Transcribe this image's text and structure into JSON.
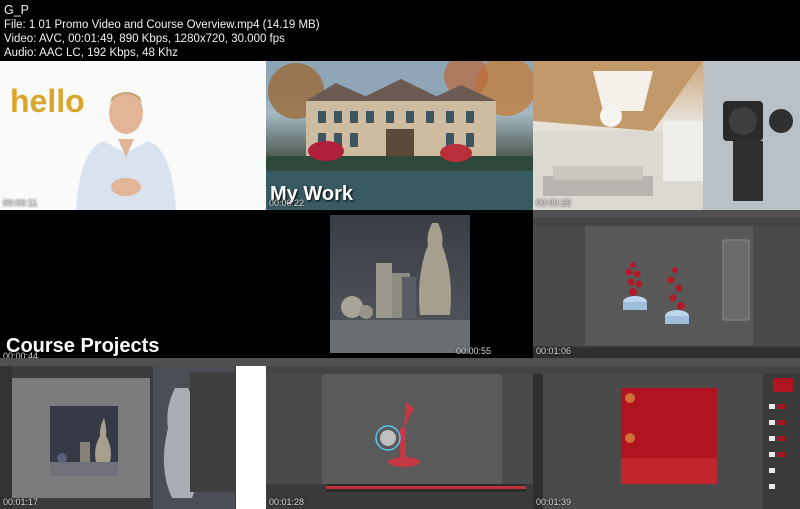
{
  "header": {
    "title": "G_P",
    "file_line": "File: 1 01  Promo Video and Course Overview.mp4 (14.19 MB)",
    "video_line": "Video: AVC, 00:01:49, 890 Kbps, 1280x720, 30.000 fps",
    "audio_line": "Audio: AAC LC, 192 Kbps, 48 Khz"
  },
  "tiles": [
    {
      "timestamp": "00:00:11",
      "overlay": "hello"
    },
    {
      "timestamp": "00:00:22",
      "overlay": "My Work"
    },
    {
      "timestamp": "00:00:33",
      "overlay": ""
    },
    {
      "timestamp": "00:00:44",
      "overlay": "Course Projects"
    },
    {
      "timestamp": "00:00:55",
      "overlay": ""
    },
    {
      "timestamp": "00:01:06",
      "overlay": ""
    },
    {
      "timestamp": "00:01:17",
      "overlay": ""
    },
    {
      "timestamp": "00:01:28",
      "overlay": ""
    },
    {
      "timestamp": "00:01:39",
      "overlay": ""
    }
  ],
  "colors": {
    "hello": "#d9a629",
    "red_canvas": "#b0141e",
    "ui_dark": "#3a3a3a",
    "timeline_red": "#c0303a"
  }
}
